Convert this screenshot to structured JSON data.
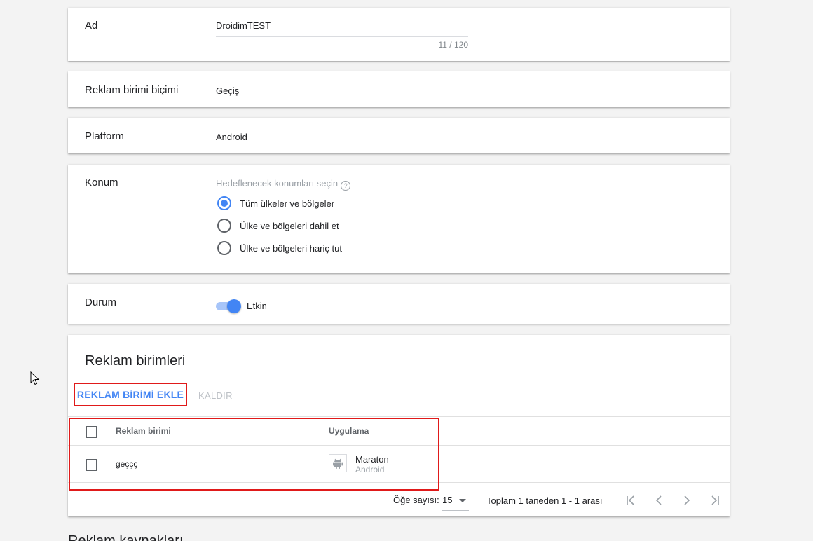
{
  "ad": {
    "label": "Ad",
    "value": "DroidimTEST",
    "counter": "11 / 120"
  },
  "format": {
    "label": "Reklam birimi biçimi",
    "value": "Geçiş"
  },
  "platform": {
    "label": "Platform",
    "value": "Android"
  },
  "location": {
    "label": "Konum",
    "hint": "Hedeflenecek konumları seçin",
    "help_icon": "?",
    "options": [
      "Tüm ülkeler ve bölgeler",
      "Ülke ve bölgeleri dahil et",
      "Ülke ve bölgeleri hariç tut"
    ],
    "selected_index": 0
  },
  "status": {
    "label": "Durum",
    "toggle_label": "Etkin",
    "enabled": true
  },
  "units": {
    "title": "Reklam birimleri",
    "add_button": "REKLAM BİRİMİ EKLE",
    "remove_button": "KALDIR",
    "columns": [
      "Reklam birimi",
      "Uygulama"
    ],
    "rows": [
      {
        "unit": "geççç",
        "app_name": "Maraton",
        "app_platform": "Android"
      }
    ]
  },
  "pager": {
    "items_label": "Öğe sayısı:",
    "items_value": "15",
    "total": "Toplam 1 taneden 1 - 1 arası"
  },
  "next_section": "Reklam kaynakları",
  "colors": {
    "accent": "#4285f4",
    "highlight": "#e01a1a"
  }
}
